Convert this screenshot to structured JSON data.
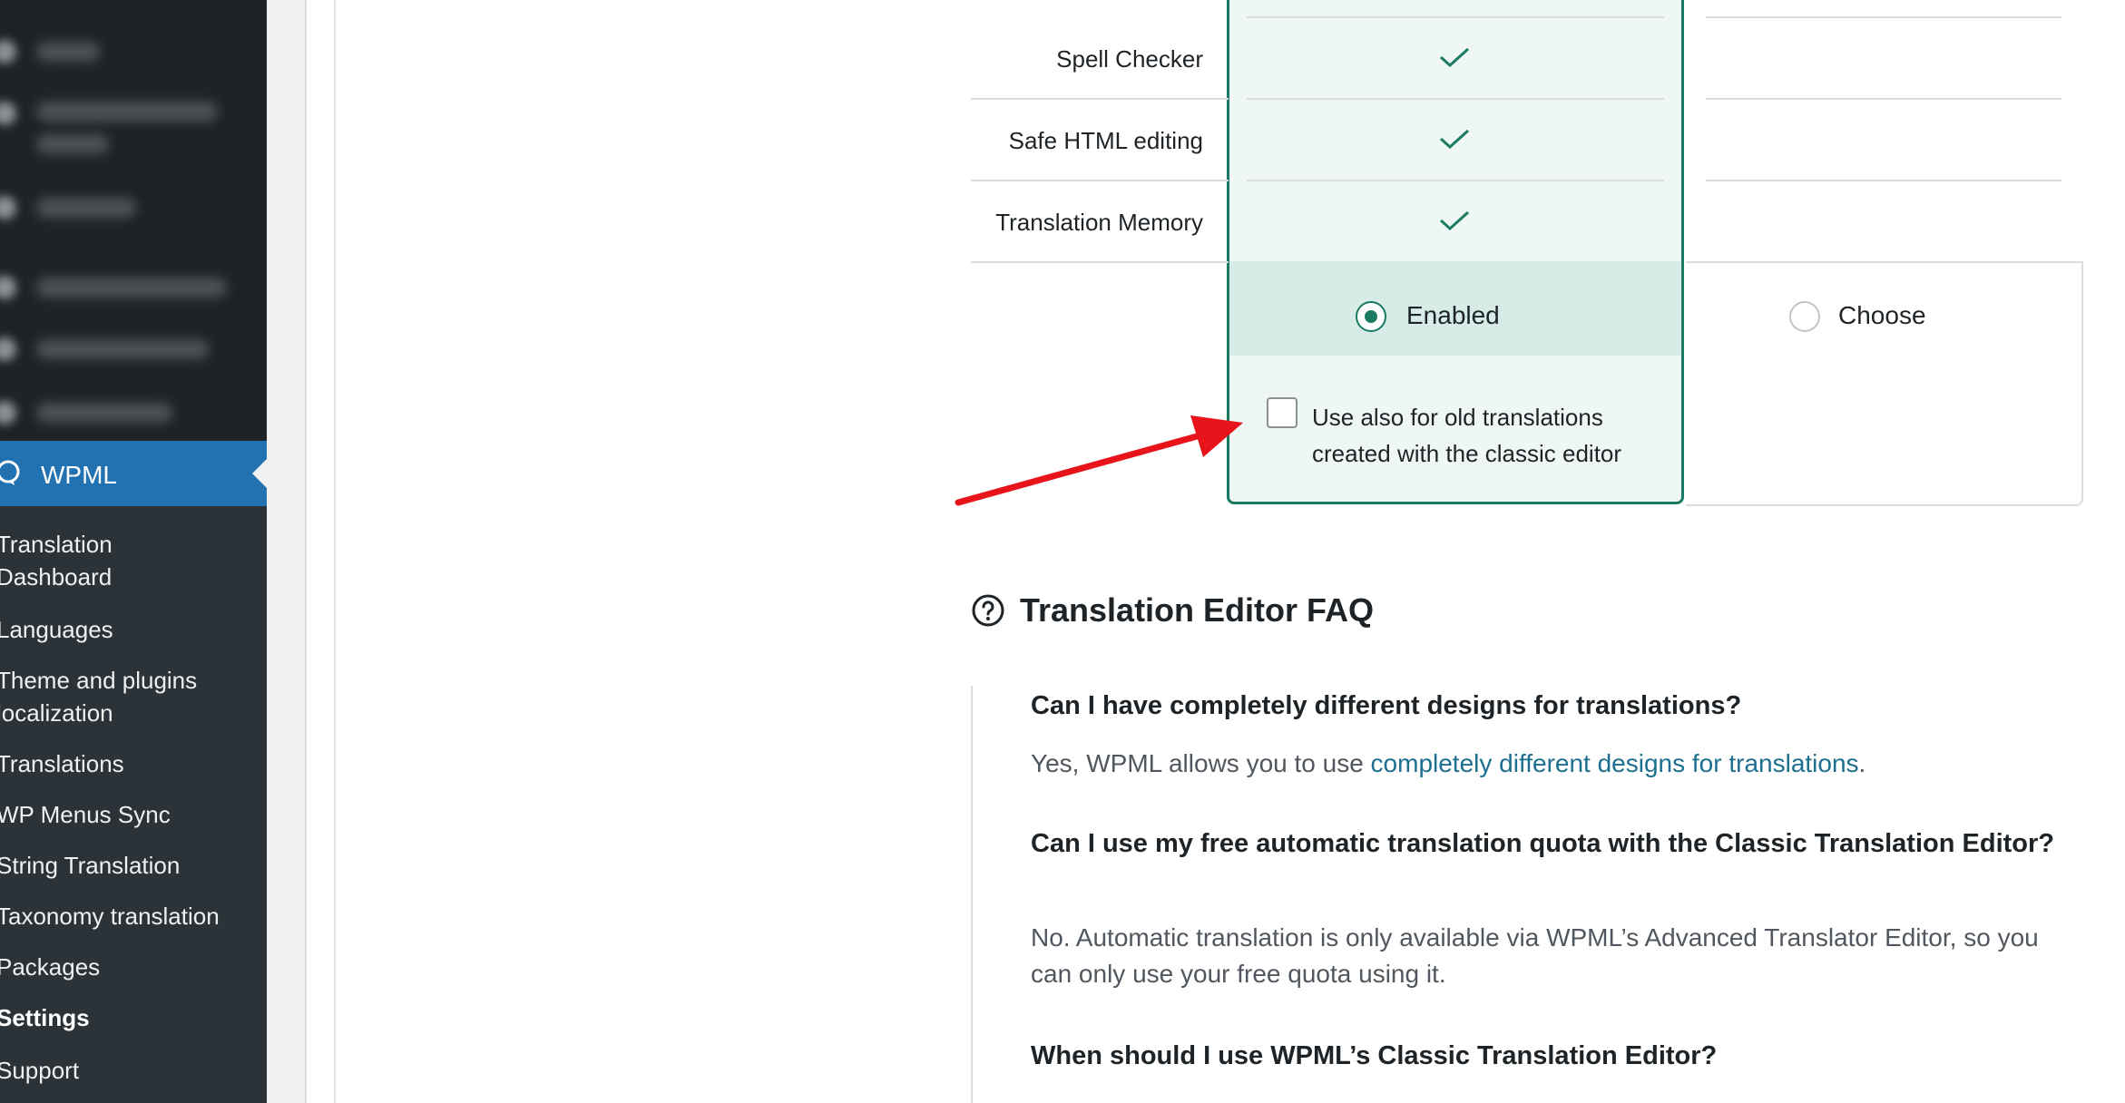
{
  "sidebar": {
    "menu_title": "WPML",
    "items": [
      {
        "label": "Translation Dashboard"
      },
      {
        "label": "Languages"
      },
      {
        "label": "Theme and plugins localization"
      },
      {
        "label": "Translations"
      },
      {
        "label": "WP Menus Sync"
      },
      {
        "label": "String Translation"
      },
      {
        "label": "Taxonomy translation"
      },
      {
        "label": "Packages"
      },
      {
        "label": "Settings"
      },
      {
        "label": "Support"
      }
    ]
  },
  "features": {
    "rows": [
      {
        "label": "Spell Checker"
      },
      {
        "label": "Safe HTML editing"
      },
      {
        "label": "Translation Memory"
      }
    ],
    "enabled_option": {
      "label": "Enabled",
      "selected": true
    },
    "choose_option": {
      "label": "Choose",
      "selected": false
    },
    "old_translations_checkbox": {
      "label": "Use also for old translations created with the classic editor",
      "checked": false
    }
  },
  "faq": {
    "title": "Translation Editor FAQ",
    "items": [
      {
        "question": "Can I have completely different designs for translations?",
        "answer_prefix": "Yes, WPML allows you to use ",
        "answer_link": "completely different designs for translations",
        "answer_suffix": "."
      },
      {
        "question": "Can I use my free automatic translation quota with the Classic Translation Editor?",
        "answer": "No. Automatic translation is only available via WPML’s Advanced Translator Editor, so you can only use your free quota using it."
      },
      {
        "question": "When should I use WPML’s Classic Translation Editor?"
      }
    ]
  },
  "colors": {
    "sidebar_bg": "#2c3338",
    "sidebar_active": "#2271b1",
    "accent_green": "#1b7a62",
    "link": "#1d6f8f",
    "annotation_arrow": "#e8141b"
  },
  "icons": [
    "wpml-icon",
    "check-icon",
    "help-circle-icon",
    "annotation-arrow"
  ]
}
